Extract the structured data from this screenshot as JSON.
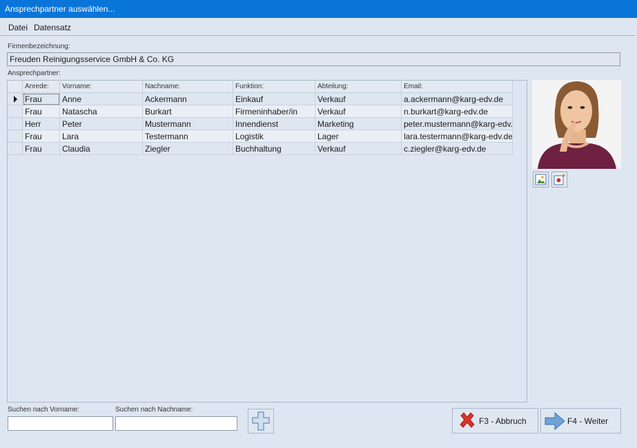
{
  "window": {
    "title": "Ansprechpartner auswählen..."
  },
  "menu": {
    "items": [
      "Datei",
      "Datensatz"
    ]
  },
  "company": {
    "label": "Firmenbezeichnung:",
    "value": "Freuden Reinigungsservice GmbH & Co. KG"
  },
  "contacts": {
    "label": "Ansprechpartner:",
    "columns": [
      "Anrede:",
      "Vorname:",
      "Nachname:",
      "Funktion:",
      "Abteilung:",
      "Email:"
    ],
    "rows": [
      [
        "Frau",
        "Anne",
        "Ackermann",
        "Einkauf",
        "Verkauf",
        "a.ackermann@karg-edv.de"
      ],
      [
        "Frau",
        "Natascha",
        "Burkart",
        "Firmeninhaber/in",
        "Verkauf",
        "n.burkart@karg-edv.de"
      ],
      [
        "Herr",
        "Peter",
        "Mustermann",
        "Innendienst",
        "Marketing",
        "peter.mustermann@karg-edv.de"
      ],
      [
        "Frau",
        "Lara",
        "Testermann",
        "Logistik",
        "Lager",
        "lara.testermann@karg-edv.de"
      ],
      [
        "Frau",
        "Claudia",
        "Ziegler",
        "Buchhaltung",
        "Verkauf",
        "c.ziegler@karg-edv.de"
      ]
    ]
  },
  "search": {
    "firstname_label": "Suchen nach Vorname:",
    "firstname_value": "",
    "lastname_label": "Suchen nach Nachname:",
    "lastname_value": ""
  },
  "buttons": {
    "cancel": "F3 - Abbruch",
    "next": "F4 - Weiter"
  }
}
